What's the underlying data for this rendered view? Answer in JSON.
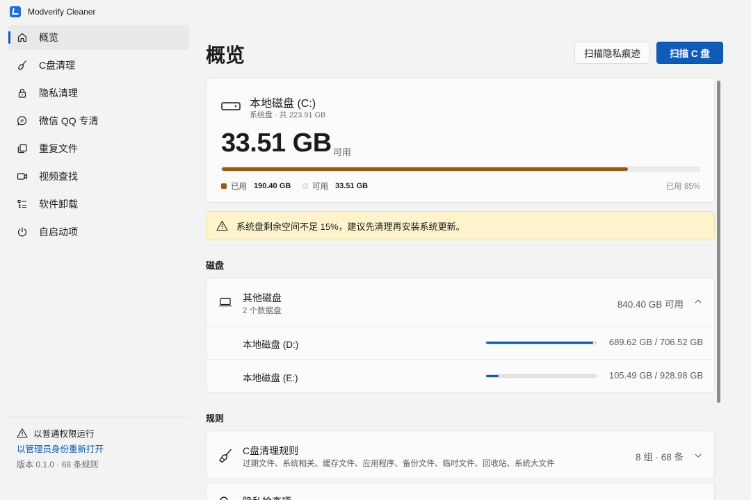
{
  "app": {
    "title": "Modverify Cleaner",
    "accent": "#0f5cb8"
  },
  "sidebar": {
    "items": [
      {
        "label": "概览",
        "icon": "home-icon",
        "active": true
      },
      {
        "label": "C盘清理",
        "icon": "broom-icon"
      },
      {
        "label": "隐私清理",
        "icon": "lock-icon"
      },
      {
        "label": "微信 QQ 专清",
        "icon": "chat-icon"
      },
      {
        "label": "重复文件",
        "icon": "copy-icon"
      },
      {
        "label": "视频查找",
        "icon": "video-icon"
      },
      {
        "label": "软件卸载",
        "icon": "list-icon"
      },
      {
        "label": "自启动项",
        "icon": "power-icon"
      }
    ],
    "footer": {
      "privilege": "以普通权限运行",
      "relaunch": "以管理员身份重新打开",
      "version": "版本 0.1.0 · 68 条规则"
    }
  },
  "header": {
    "title": "概览",
    "scan_privacy": "扫描隐私痕迹",
    "scan_c": "扫描 C 盘"
  },
  "c_drive": {
    "name": "本地磁盘 (C:)",
    "subtitle": "系统盘 · 共 223.91 GB",
    "free": "33.51 GB",
    "free_unit": "可用",
    "used_fraction": 0.85,
    "used_label": "已用",
    "used_value": "190.40 GB",
    "free_label": "可用",
    "free_value": "33.51 GB",
    "percent_label": "已用 85%",
    "used_color": "#9a5a0e"
  },
  "warning": {
    "text": "系统盘剩余空间不足 15%，建议先清理再安装系统更新。"
  },
  "disks": {
    "section": "磁盘",
    "group_title": "其他磁盘",
    "group_sub": "2 个数据盘",
    "group_free": "840.40 GB 可用",
    "drives": [
      {
        "name": "本地磁盘 (D:)",
        "value": "689.62 GB / 706.52 GB",
        "fraction": 0.976
      },
      {
        "name": "本地磁盘 (E:)",
        "value": "105.49 GB / 928.98 GB",
        "fraction": 0.114
      }
    ]
  },
  "rules": {
    "section": "规则",
    "items": [
      {
        "title": "C盘清理规则",
        "sub": "过期文件、系统相关、缓存文件、应用程序、备份文件、临时文件、回收站、系统大文件",
        "count": "8 组 · 68 条"
      },
      {
        "title": "隐私检查项"
      }
    ]
  }
}
